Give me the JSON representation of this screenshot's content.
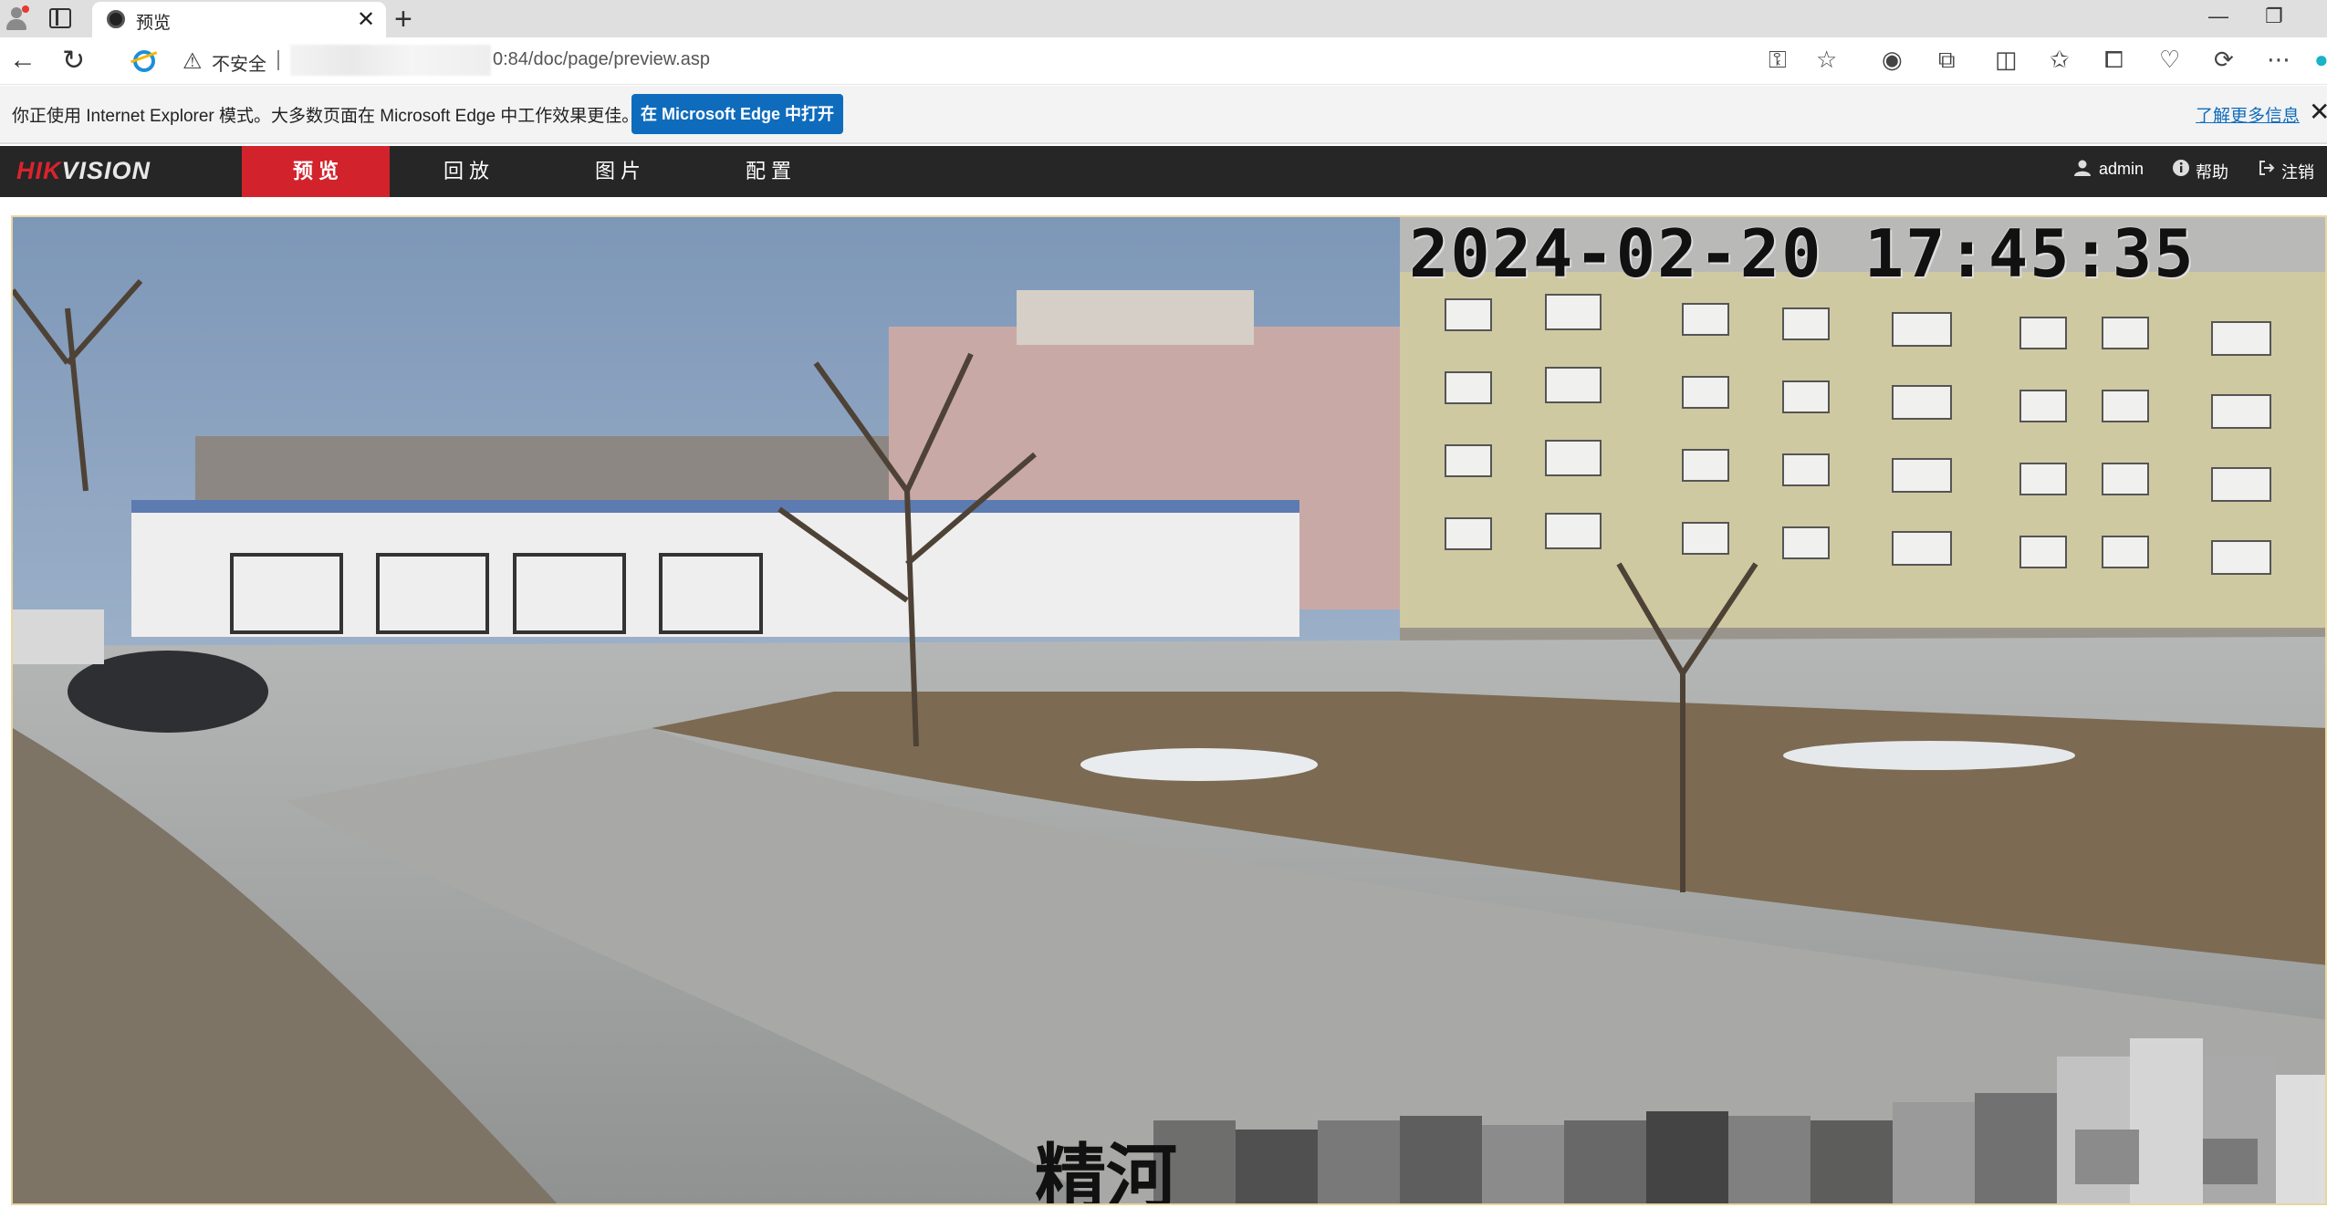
{
  "browser": {
    "tab": {
      "title": "预览"
    },
    "address": {
      "security_label": "不安全",
      "url": "0:84/doc/page/preview.asp"
    },
    "ie_mode_bar": {
      "message": "你正使用 Internet Explorer 模式。大多数页面在 Microsoft Edge 中工作效果更佳。",
      "open_button": "在 Microsoft Edge 中打开",
      "learn_more": "了解更多信息"
    }
  },
  "app": {
    "logo": {
      "brand_red": "HIK",
      "brand_rest": "VISION"
    },
    "nav": [
      {
        "label": "预 览",
        "active": true
      },
      {
        "label": "回 放",
        "active": false
      },
      {
        "label": "图 片",
        "active": false
      },
      {
        "label": "配 置",
        "active": false
      }
    ],
    "user": {
      "username": "admin",
      "help": "帮助",
      "logout": "注销"
    },
    "colors": {
      "active_tab": "#d2232c",
      "header_bg": "#262626",
      "accent_blue": "#0f6cbd"
    }
  },
  "video": {
    "timestamp": "2024-02-20 17:45:35",
    "channel_name_visible": "精河"
  }
}
